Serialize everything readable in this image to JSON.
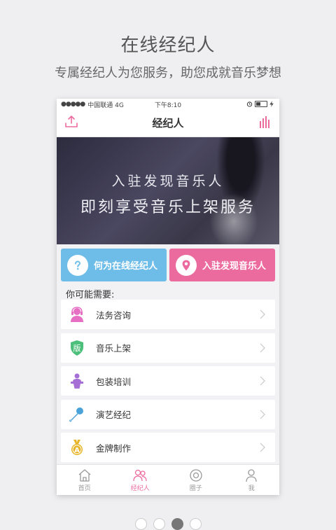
{
  "promo": {
    "title": "在线经纪人",
    "subtitle": "专属经纪人为您服务，助您成就音乐梦想"
  },
  "status_bar": {
    "signal": "●●●●●",
    "carrier": "中国联通 4G",
    "time": "下午8:10"
  },
  "navbar": {
    "title": "经纪人",
    "left_icon": "upload-icon",
    "right_icon": "equalizer-icon"
  },
  "banner": {
    "line1": "入驻发现音乐人",
    "line2": "即刻享受音乐上架服务"
  },
  "buttons": {
    "what_is": "何为在线经纪人",
    "join": "入驻发现音乐人"
  },
  "section_label": "你可能需要:",
  "services": [
    {
      "label": "法务咨询",
      "icon": "headset-person-icon",
      "color": "#e66fc4"
    },
    {
      "label": "音乐上架",
      "icon": "shield-badge-icon",
      "color": "#4cbf7a",
      "badge_text": "版"
    },
    {
      "label": "包装培训",
      "icon": "speaker-podium-icon",
      "color": "#a56fd6"
    },
    {
      "label": "演艺经纪",
      "icon": "microphone-icon",
      "color": "#4aa3d8"
    },
    {
      "label": "金牌制作",
      "icon": "gold-medal-icon",
      "color": "#e6b52a",
      "badge_text": "A"
    }
  ],
  "tabs": [
    {
      "label": "首页",
      "icon": "home-icon",
      "active": false
    },
    {
      "label": "经纪人",
      "icon": "people-icon",
      "active": true
    },
    {
      "label": "圈子",
      "icon": "circle-icon",
      "active": false
    },
    {
      "label": "我",
      "icon": "user-icon",
      "active": false
    }
  ],
  "colors": {
    "accent_pink": "#ec6b9f",
    "accent_blue": "#6ebde8"
  },
  "pager": {
    "count": 4,
    "active_index": 2
  }
}
